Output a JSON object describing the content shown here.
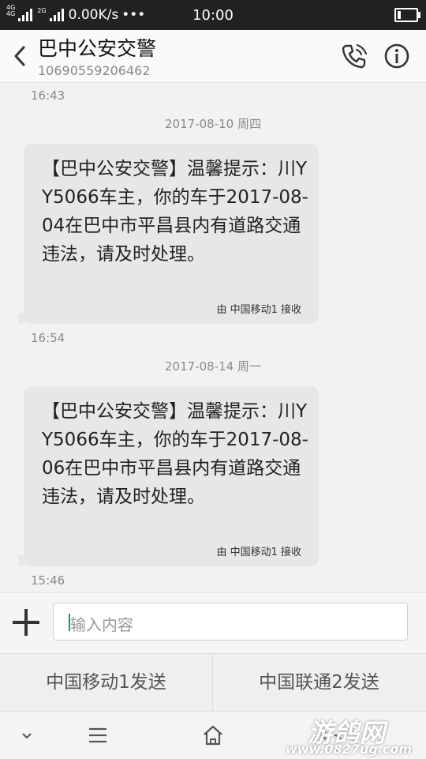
{
  "statusbar": {
    "speed": "0.00K/s",
    "dots": "•••",
    "time": "10:00"
  },
  "header": {
    "title": "巴中公安交警",
    "number": "10690559206462"
  },
  "thread": {
    "time1": "16:43",
    "date1": "2017-08-10 周四",
    "msg1": "【巴中公安交警】温馨提示：川YY5066车主，你的车于2017-08-04在巴中市平昌县内有道路交通违法，请及时处理。",
    "via1": "由 中国移动1 接收",
    "time2": "16:54",
    "date2": "2017-08-14 周一",
    "msg2": "【巴中公安交警】温馨提示：川YY5066车主，你的车于2017-08-06在巴中市平昌县内有道路交通违法，请及时处理。",
    "via2": "由 中国移动1 接收",
    "time3": "15:46"
  },
  "composer": {
    "placeholder": "输入内容"
  },
  "send": {
    "sim1": "中国移动1发送",
    "sim2": "中国联通2发送"
  },
  "watermark": {
    "name": "游鸽网",
    "url": "www.0827ug.com"
  },
  "icons": {
    "back": "back-arrow-icon",
    "call": "phone-call-icon",
    "info": "info-icon",
    "add": "plus-icon"
  }
}
